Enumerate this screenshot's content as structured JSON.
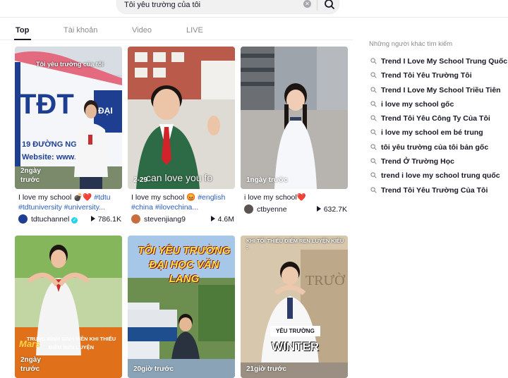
{
  "search": {
    "query": "Tôi yêu trường của tôi"
  },
  "tabs": [
    {
      "label": "Top"
    },
    {
      "label": "Tài khoản"
    },
    {
      "label": "Video"
    },
    {
      "label": "LIVE"
    }
  ],
  "videos": [
    {
      "time": "2ngày trước",
      "overlay_text": "Tôi yêu trường của tôi",
      "caption_text": "I love my school 💣❤️ ",
      "tags": "#tdtu #tdtuniversity #university...",
      "author": "tdtuchannel",
      "verified": true,
      "views": "786.1K"
    },
    {
      "time": "2-29",
      "overlay_text": "can love you fo",
      "caption_text": "I love my school 😡 ",
      "tags": "#english #china #ilovechina...",
      "author": "stevenjiang9",
      "verified": false,
      "views": "4.6M"
    },
    {
      "time": "1ngày trước",
      "overlay_text": "",
      "caption_text": "i love my school❤️",
      "tags": "",
      "author": "ctbyenne",
      "verified": false,
      "views": "632.7K"
    },
    {
      "time": "2ngày trước",
      "overlay_text": "TRUNG BÌNH SINH VIÊN KHI THIẾU ĐIỂM RÈN LUYỆN",
      "caption_text": "",
      "tags": "",
      "author": "",
      "verified": false,
      "views": ""
    },
    {
      "time": "20giờ trước",
      "overlay_text": "TÔI YÊU TRƯỜNG ĐẠI HỌC VĂN LANG",
      "caption_text": "",
      "tags": "",
      "author": "",
      "verified": false,
      "views": ""
    },
    {
      "time": "21giờ trước",
      "overlay_text": "KHI TÔI THIẾU ĐIỂM RÈN LUYỆN KIỂU :",
      "overlay_text_2": "YÊU TRƯỜNG",
      "overlay_text_3": "WINTER",
      "caption_text": "",
      "tags": "",
      "author": "",
      "verified": false,
      "views": ""
    }
  ],
  "others": {
    "title": "Những người khác tìm kiếm",
    "items": [
      "Trend I Love My School Trung Quốc",
      "Trend Tôi Yêu Trường Tôi",
      "Trend I Love My School Triều Tiên",
      "i love my school gốc",
      "Trend Tôi Yêu Công Ty Của Tôi",
      "i love my school em bé trung",
      "tôi yêu trường của tôi bản gốc",
      "Trend Ở Trường Học",
      "trend i love my school trung quốc",
      "Trend Tôi Yêu Trường Của Tôi"
    ]
  },
  "colors": {
    "tag": "#2b5db9",
    "text": "#161823",
    "muted": "#8a8b91",
    "verified": "#20d5ec"
  }
}
